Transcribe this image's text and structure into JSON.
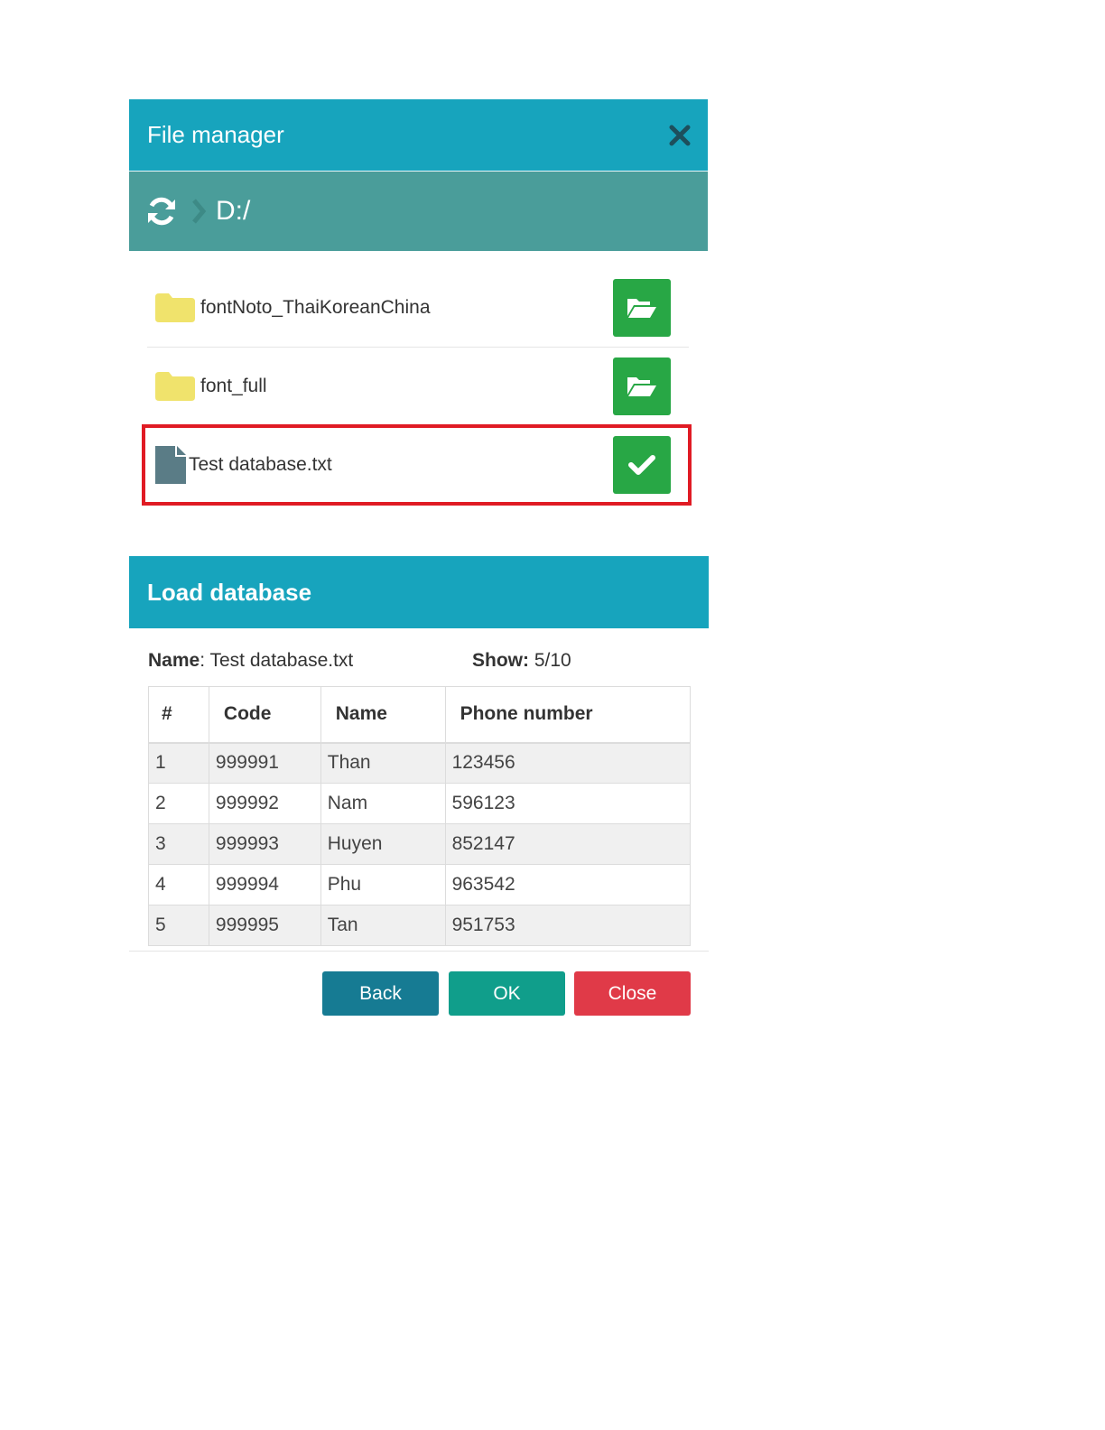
{
  "file_manager": {
    "title": "File manager",
    "path": "D:/",
    "items": [
      {
        "name": "fontNoto_ThaiKoreanChina",
        "type": "folder",
        "action_icon": "folder-open-icon"
      },
      {
        "name": "font_full",
        "type": "folder",
        "action_icon": "folder-open-icon"
      },
      {
        "name": "Test database.txt",
        "type": "file",
        "action_icon": "check-icon",
        "selected": true
      }
    ]
  },
  "load_database": {
    "title": "Load database",
    "name_label": "Name",
    "name_value": ": Test database.txt",
    "show_label": "Show:",
    "show_value": " 5/10",
    "columns": [
      "#",
      "Code",
      "Name",
      "Phone number"
    ],
    "rows": [
      [
        "1",
        "999991",
        "Than",
        "123456"
      ],
      [
        "2",
        "999992",
        "Nam",
        "596123"
      ],
      [
        "3",
        "999993",
        "Huyen",
        "852147"
      ],
      [
        "4",
        "999994",
        "Phu",
        "963542"
      ],
      [
        "5",
        "999995",
        "Tan",
        "951753"
      ]
    ],
    "buttons": {
      "back": "Back",
      "ok": "OK",
      "close": "Close"
    }
  },
  "colors": {
    "header": "#17a4bd",
    "path_bar": "#4a9d9a",
    "green_button": "#28a745",
    "selection_outline": "#e01b24",
    "back_button": "#167b93",
    "ok_button": "#109e8b",
    "close_button": "#e03a48",
    "folder": "#f0e36c",
    "file": "#5a7c86"
  }
}
